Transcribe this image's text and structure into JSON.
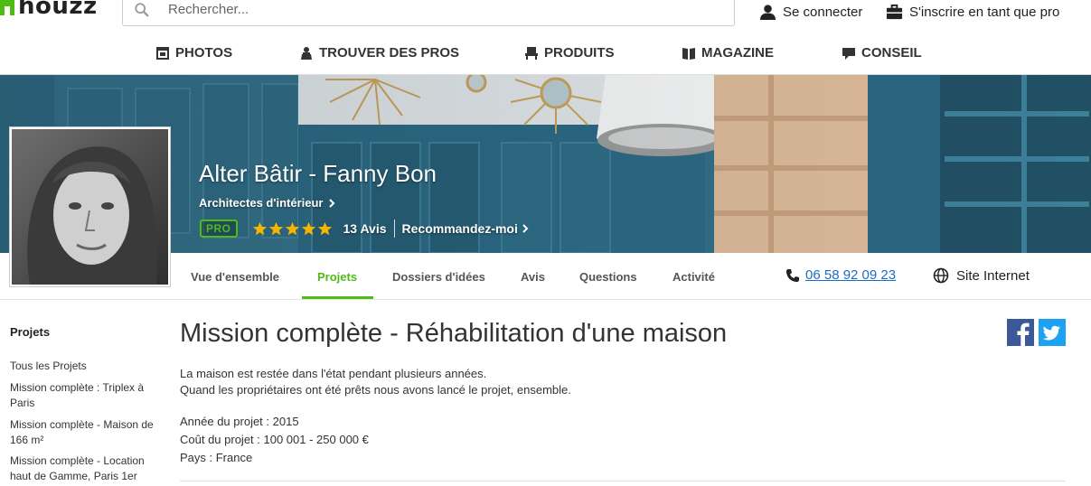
{
  "header": {
    "logo_text": "houzz",
    "search_placeholder": "Rechercher...",
    "login_label": "Se connecter",
    "signup_pro_label": "S'inscrire en tant que pro"
  },
  "nav": {
    "items": [
      {
        "label": "PHOTOS",
        "icon": "photos-icon"
      },
      {
        "label": "TROUVER DES PROS",
        "icon": "pro-icon"
      },
      {
        "label": "PRODUITS",
        "icon": "products-icon"
      },
      {
        "label": "MAGAZINE",
        "icon": "magazine-icon"
      },
      {
        "label": "CONSEIL",
        "icon": "advice-icon"
      }
    ]
  },
  "profile": {
    "name": "Alter Bâtir - Fanny Bon",
    "category": "Architectes d'intérieur",
    "badge": "PRO",
    "rating": 5,
    "reviews": "13 Avis",
    "recommend": "Recommandez-moi",
    "phone": "06 58 92 09 23",
    "website_label": "Site Internet",
    "accent_color": "#4dbc15",
    "star_color": "#f7b500"
  },
  "tabs": [
    {
      "label": "Vue d'ensemble",
      "active": false
    },
    {
      "label": "Projets",
      "active": true
    },
    {
      "label": "Dossiers d'idées",
      "active": false
    },
    {
      "label": "Avis",
      "active": false
    },
    {
      "label": "Questions",
      "active": false
    },
    {
      "label": "Activité",
      "active": false
    }
  ],
  "sidebar": {
    "title": "Projets",
    "links": [
      {
        "label": "Tous les Projets"
      },
      {
        "label": "Mission complète : Triplex à Paris"
      },
      {
        "label": "Mission complète - Maison de 166 m²"
      },
      {
        "label": "Mission complète - Location haut de Gamme, Paris 1er"
      }
    ]
  },
  "project": {
    "title": "Mission complète - Réhabilitation d'une maison",
    "description_lines": [
      "La maison est restée dans l'état pendant plusieurs années.",
      "Quand les propriétaires ont été prêts nous avons lancé le projet, ensemble."
    ],
    "facts": [
      "Année du projet : 2015",
      "Coût du projet : 100 001 - 250 000 €",
      "Pays : France"
    ]
  },
  "share": {
    "facebook_color": "#3b5998",
    "twitter_color": "#1da1f2"
  }
}
